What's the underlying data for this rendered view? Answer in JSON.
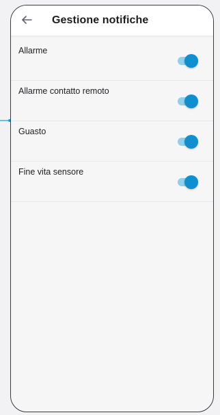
{
  "header": {
    "title": "Gestione notifiche",
    "back_icon": "arrow-left-icon"
  },
  "settings": [
    {
      "label": "Allarme",
      "enabled": true
    },
    {
      "label": "Allarme contatto remoto",
      "enabled": true
    },
    {
      "label": "Guasto",
      "enabled": true
    },
    {
      "label": "Fine vita sensore",
      "enabled": true
    }
  ],
  "colors": {
    "accent": "#0f8ed0",
    "track": "#8fd0ea",
    "connector": "#1a9ad6"
  }
}
